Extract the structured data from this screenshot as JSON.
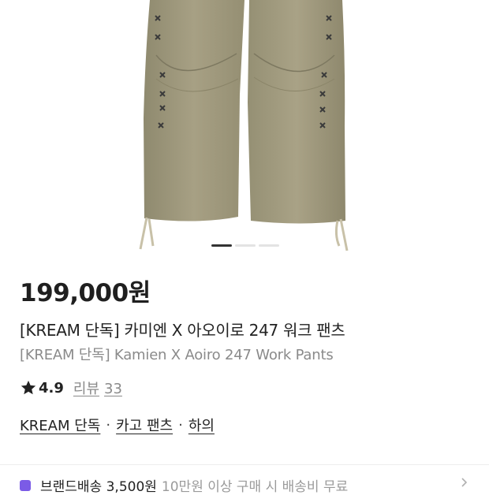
{
  "product": {
    "price": "199,000원",
    "title_ko": "[KREAM 단독] 카미엔 X 아오이로 247 워크 팬츠",
    "title_en": "[KREAM 단독] Kamien X Aoiro 247 Work Pants",
    "image_icon": "cargo-pants-photo"
  },
  "carousel": {
    "total": 3,
    "active_index": 0
  },
  "rating": {
    "value": "4.9",
    "review_label": "리뷰",
    "review_count": "33",
    "icon": "star-icon"
  },
  "categories": [
    {
      "label": "KREAM 단독"
    },
    {
      "label": "카고 팬츠"
    },
    {
      "label": "하의"
    }
  ],
  "category_separator": "·",
  "shipping": {
    "label": "브랜드배송 3,500원",
    "sub": "10만원 이상 구매 시 배송비 무료",
    "icon": "brand-delivery-icon",
    "chevron_icon": "chevron-right-icon"
  },
  "colors": {
    "accent": "#7b5be6",
    "pants": "#9e9779"
  }
}
